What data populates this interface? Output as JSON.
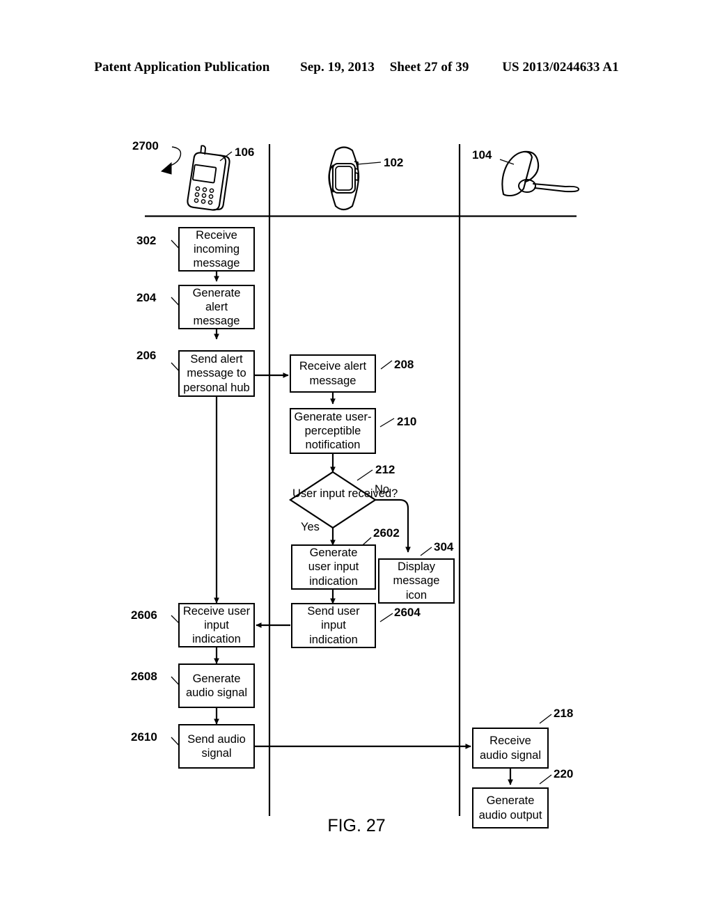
{
  "header": {
    "publication": "Patent Application Publication",
    "date": "Sep. 19, 2013",
    "sheet": "Sheet 27 of 39",
    "patent_number": "US 2013/0244633 A1"
  },
  "figure": {
    "caption": "FIG. 27",
    "diagram_ref": "2700",
    "lanes": [
      {
        "id": "lane-phone",
        "device_ref": "106",
        "device_icon": "mobile-phone-icon"
      },
      {
        "id": "lane-watch",
        "device_ref": "102",
        "device_icon": "wristwatch-icon"
      },
      {
        "id": "lane-headset",
        "device_ref": "104",
        "device_icon": "bluetooth-headset-icon"
      }
    ],
    "boxes": [
      {
        "ref": "302",
        "text": "Receive incoming message"
      },
      {
        "ref": "204",
        "text": "Generate alert message"
      },
      {
        "ref": "206",
        "text": "Send alert message to personal hub"
      },
      {
        "ref": "208",
        "text": "Receive alert message"
      },
      {
        "ref": "210",
        "text": "Generate user-perceptible notification"
      },
      {
        "ref": "2602",
        "text": "Generate user input indication"
      },
      {
        "ref": "304",
        "text": "Display message icon"
      },
      {
        "ref": "2604",
        "text": "Send user input indication"
      },
      {
        "ref": "2606",
        "text": "Receive user input indication"
      },
      {
        "ref": "2608",
        "text": "Generate audio signal"
      },
      {
        "ref": "2610",
        "text": "Send audio signal"
      },
      {
        "ref": "218",
        "text": "Receive audio signal"
      },
      {
        "ref": "220",
        "text": "Generate audio output"
      }
    ],
    "decision": {
      "ref": "212",
      "line1": "User input",
      "line2": "received?",
      "branch_yes": "Yes",
      "branch_no": "No"
    },
    "box_lines": {
      "b302": [
        "Receive",
        "incoming",
        "message"
      ],
      "b204": [
        "Generate",
        "alert",
        "message"
      ],
      "b206": [
        "Send alert",
        "message to",
        "personal hub"
      ],
      "b208": [
        "Receive alert",
        "message"
      ],
      "b210": [
        "Generate user-",
        "perceptible",
        "notification"
      ],
      "b2602": [
        "Generate",
        "user input",
        "indication"
      ],
      "b304": [
        "Display",
        "message",
        "icon"
      ],
      "b2604": [
        "Send user",
        "input",
        "indication"
      ],
      "b2606": [
        "Receive user",
        "input",
        "indication"
      ],
      "b2608": [
        "Generate",
        "audio signal"
      ],
      "b2610": [
        "Send audio",
        "signal"
      ],
      "b218": [
        "Receive",
        "audio signal"
      ],
      "b220": [
        "Generate",
        "audio output"
      ]
    }
  },
  "colors": {
    "ink": "#000000",
    "paper": "#ffffff"
  }
}
